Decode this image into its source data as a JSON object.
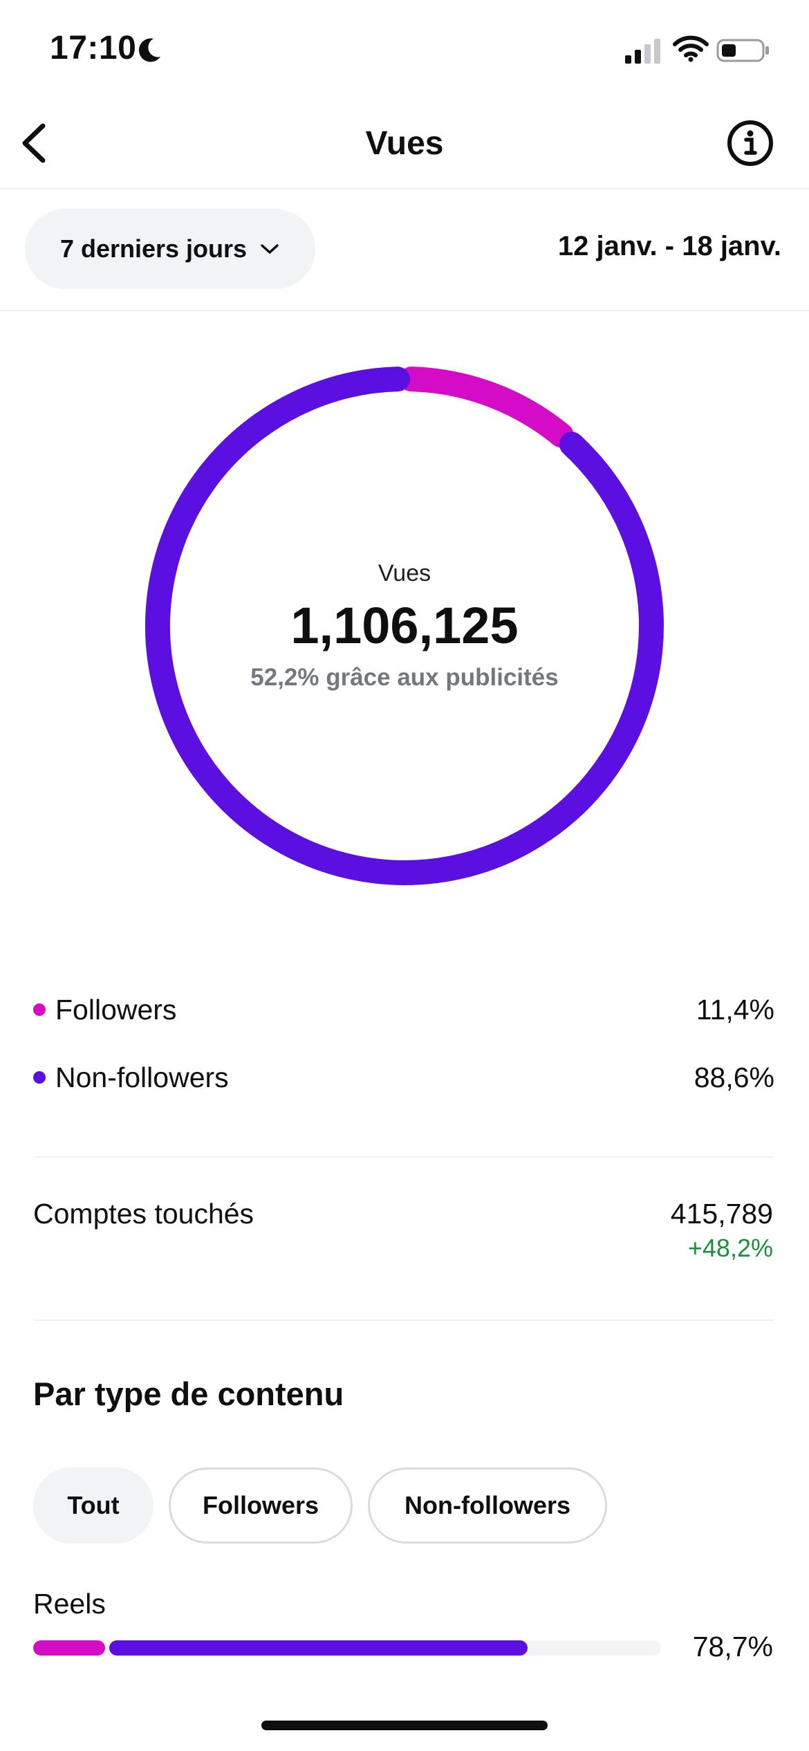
{
  "status_bar": {
    "time": "17:10"
  },
  "header": {
    "title": "Vues"
  },
  "period": {
    "selector_label": "7 derniers jours",
    "date_range": "12 janv. - 18 janv."
  },
  "donut": {
    "center_label": "Vues",
    "total": "1,106,125",
    "subtitle": "52,2% grâce aux publicités",
    "segments": [
      {
        "name": "Followers",
        "percent": 11.4,
        "color": "#d40bc7"
      },
      {
        "name": "Non-followers",
        "percent": 88.6,
        "color": "#5b0fe0"
      }
    ]
  },
  "legend": [
    {
      "label": "Followers",
      "value": "11,4%",
      "color": "#d40bc7"
    },
    {
      "label": "Non-followers",
      "value": "88,6%",
      "color": "#5b0fe0"
    }
  ],
  "comptes": {
    "label": "Comptes touchés",
    "value": "415,789",
    "delta": "+48,2%"
  },
  "content_type": {
    "title": "Par type de contenu",
    "filters": [
      "Tout",
      "Followers",
      "Non-followers"
    ],
    "selected_filter": "Tout",
    "rows": [
      {
        "label": "Reels",
        "value": "78,7%",
        "followers_share_percent": 11.4,
        "non_followers_share_percent": 67.3
      }
    ]
  },
  "colors": {
    "followers": "#d40bc7",
    "non_followers": "#5b0fe0",
    "positive": "#1a8f3c"
  }
}
